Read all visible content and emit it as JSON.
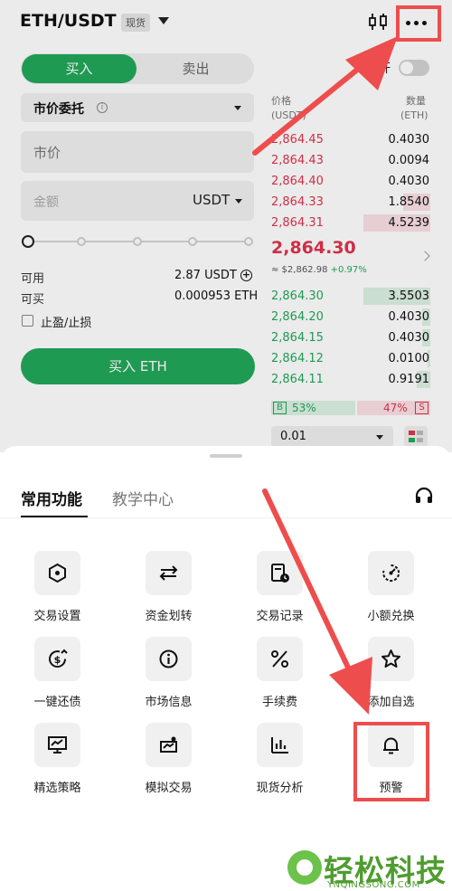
{
  "header": {
    "pair": "ETH/USDT",
    "market_tag": "现货",
    "chart_icon": "candlestick-chart-icon",
    "more_icon": "more-dots-icon"
  },
  "order_form": {
    "buy_tab": "买入",
    "sell_tab": "卖出",
    "leverage_label": "杠杆",
    "leverage_enabled": false,
    "order_type": "市价委托",
    "price_placeholder": "市价",
    "amount_placeholder": "金额",
    "amount_unit": "USDT",
    "slider_percent": 0,
    "available_label": "可用",
    "available_value": "2.87 USDT",
    "can_buy_label": "可买",
    "can_buy_value": "0.000953 ETH",
    "tpsl_label": "止盈/止损",
    "submit_label": "买入 ETH"
  },
  "orderbook": {
    "price_header": "价格",
    "price_unit": "(USDT)",
    "qty_header": "数量",
    "qty_unit": "(ETH)",
    "asks": [
      {
        "price": "2,864.45",
        "qty": "0.4030",
        "depth": 0
      },
      {
        "price": "2,864.43",
        "qty": "0.0094",
        "depth": 0
      },
      {
        "price": "2,864.40",
        "qty": "0.4030",
        "depth": 0
      },
      {
        "price": "2,864.33",
        "qty": "1.8540",
        "depth": 0.4
      },
      {
        "price": "2,864.31",
        "qty": "4.5239",
        "depth": 1.0
      }
    ],
    "last_price": "2,864.30",
    "last_usd": "≈ $2,862.98",
    "change": "+0.97%",
    "bids": [
      {
        "price": "2,864.30",
        "qty": "3.5503",
        "depth": 1.0
      },
      {
        "price": "2,864.20",
        "qty": "0.4030",
        "depth": 0.12
      },
      {
        "price": "2,864.15",
        "qty": "0.4030",
        "depth": 0.12
      },
      {
        "price": "2,864.12",
        "qty": "0.0100",
        "depth": 0.04
      },
      {
        "price": "2,864.11",
        "qty": "0.9191",
        "depth": 0.2
      }
    ],
    "buy_label": "B",
    "buy_ratio": "53%",
    "sell_ratio": "47%",
    "sell_label": "S",
    "precision": "0.01"
  },
  "sheet": {
    "tab_common": "常用功能",
    "tab_education": "教学中心",
    "support_icon": "headset-icon",
    "items": [
      {
        "label": "交易设置",
        "icon": "hexagon-settings-icon"
      },
      {
        "label": "资金划转",
        "icon": "transfer-arrows-icon"
      },
      {
        "label": "交易记录",
        "icon": "record-clock-icon"
      },
      {
        "label": "小额兑换",
        "icon": "dust-convert-icon"
      },
      {
        "label": "一键还债",
        "icon": "repay-dollar-icon"
      },
      {
        "label": "市场信息",
        "icon": "info-circle-icon"
      },
      {
        "label": "手续费",
        "icon": "percent-icon"
      },
      {
        "label": "添加自选",
        "icon": "star-icon"
      },
      {
        "label": "精选策略",
        "icon": "strategy-chart-icon"
      },
      {
        "label": "模拟交易",
        "icon": "demo-trade-icon"
      },
      {
        "label": "现货分析",
        "icon": "bar-analysis-icon"
      },
      {
        "label": "预警",
        "icon": "bell-icon"
      }
    ]
  },
  "watermark": {
    "brand": "轻松科技",
    "domain": "YNQINGSONG.COM"
  },
  "colors": {
    "buy_green": "#22a85a",
    "sell_red": "#e0334d",
    "highlight_red": "#ee4d4d"
  }
}
